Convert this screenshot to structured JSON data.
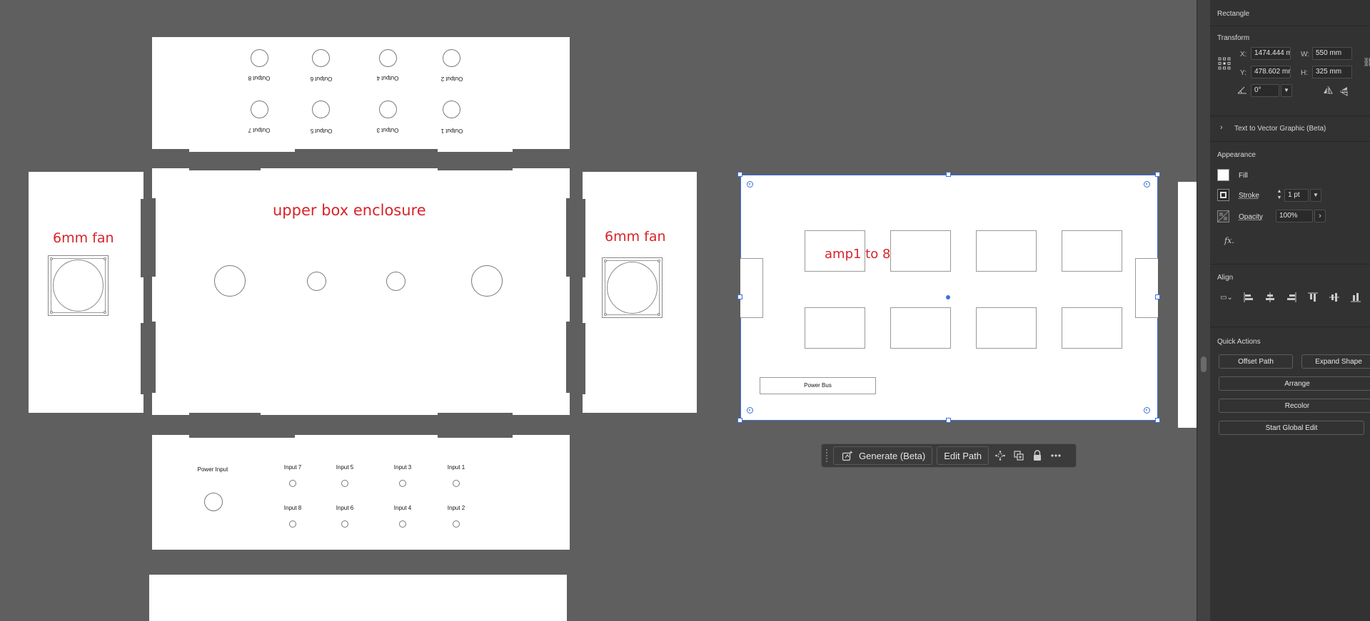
{
  "canvas": {
    "top_panel": {
      "row1_labels": [
        "Output 8",
        "Output 6",
        "Output 4",
        "Output 2"
      ],
      "row2_labels": [
        "Output 7",
        "Output 5",
        "Output 3",
        "Output 1"
      ]
    },
    "left_fan_label": "6mm fan",
    "right_fan_label": "6mm fan",
    "center_title": "upper box enclosure",
    "bottom_panel": {
      "power_input_label": "Power Input",
      "row1_labels": [
        "Input 7",
        "Input 5",
        "Input 3",
        "Input 1"
      ],
      "row2_labels": [
        "Input 8",
        "Input 6",
        "Input 4",
        "Input 2"
      ]
    },
    "selected_board": {
      "amp_label": "amp1 to 8",
      "power_bus_label": "Power Bus"
    }
  },
  "context_toolbar": {
    "generate_label": "Generate (Beta)",
    "edit_path_label": "Edit Path"
  },
  "properties": {
    "object_type": "Rectangle",
    "transform": {
      "title": "Transform",
      "x_label": "X:",
      "x_value": "1474.444 m",
      "y_label": "Y:",
      "y_value": "478.602 mr",
      "w_label": "W:",
      "w_value": "550 mm",
      "h_label": "H:",
      "h_value": "325 mm",
      "angle_value": "0°"
    },
    "text_to_vector_label": "Text to Vector Graphic (Beta)",
    "appearance": {
      "title": "Appearance",
      "fill_label": "Fill",
      "stroke_label": "Stroke",
      "stroke_value": "1 pt",
      "opacity_label": "Opacity",
      "opacity_value": "100%",
      "fx_label": "fx."
    },
    "align": {
      "title": "Align"
    },
    "quick_actions": {
      "title": "Quick Actions",
      "offset_path": "Offset Path",
      "expand_shape": "Expand Shape",
      "arrange": "Arrange",
      "recolor": "Recolor",
      "start_global_edit": "Start Global Edit"
    }
  },
  "colors": {
    "canvas_bg": "#5f5f5f",
    "annotation_red": "#d8232a",
    "selection_blue": "#3d6fe0",
    "panel_bg": "#323232"
  }
}
